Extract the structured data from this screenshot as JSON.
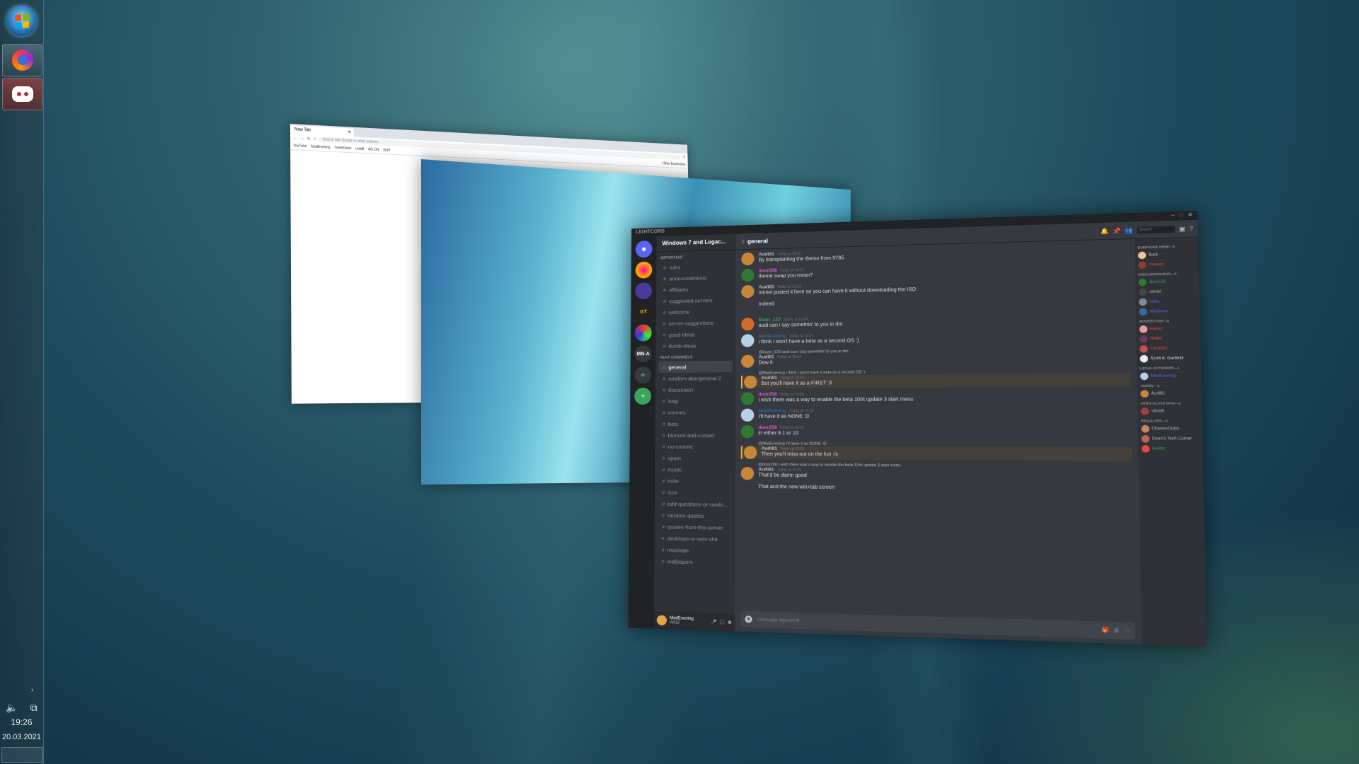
{
  "taskbar": {
    "clock": "19:26",
    "date": "20.03.2021",
    "apps": [
      {
        "name": "Firefox"
      },
      {
        "name": "Discord"
      }
    ]
  },
  "browser": {
    "tab_title": "New Tab",
    "url_placeholder": "Search with Google or enter address",
    "bookmarks": [
      "YouTube",
      "MadEvening",
      "TweetDeck",
      "reddit",
      "AG.ON",
      "Stuff"
    ],
    "other_bookmarks": "Other Bookmarks"
  },
  "discord": {
    "window_title": "LIGHTCORD",
    "server_name": "Windows 7 and Legac...",
    "categories": {
      "important": "Important",
      "text": "Text Channels"
    },
    "guild_label": "MN-A",
    "important_channels": [
      "rules",
      "announcements",
      "affiliates",
      "suggested-servers",
      "welcome",
      "server-suggestions",
      "good-ideas",
      "dumb-ideas"
    ],
    "text_channels": [
      "general",
      "random-aka-general-2",
      "discussion",
      "help",
      "memes",
      "bots",
      "blursed-and-cursed",
      "no-context",
      "spam",
      "music",
      "nsfw",
      "cum",
      "odd-questions-or-rando...",
      "random-quotes",
      "quotes-from-this-server",
      "desktops-or-som-shit",
      "mockups",
      "wallpapers"
    ],
    "active_channel": "general",
    "user": {
      "name": "MadEvening",
      "tag": "#3022"
    },
    "search_placeholder": "Search",
    "composer_placeholder": "Message #general",
    "messages": [
      {
        "author": "Audi81",
        "time": "Today at 19:20",
        "color": "#b9bbbe",
        "avatar": "#c7873a",
        "text": "By transplanting the theme from 9785",
        "reply": ""
      },
      {
        "author": "door258",
        "time": "Today at 19:22",
        "color": "#e05ad6",
        "avatar": "#2f7a33",
        "text": "theme swap you mean?",
        "reply": ""
      },
      {
        "author": "Audi81",
        "time": "Today at 19:23",
        "color": "#b9bbbe",
        "avatar": "#c7873a",
        "text": "mintel posted it here so you can have it without downloading the ISO",
        "reply": ""
      },
      {
        "author": "",
        "time": "",
        "color": "#b9bbbe",
        "avatar": "#c7873a",
        "text": "Indeed",
        "reply": ""
      },
      {
        "author": "Kaan_123",
        "time": "Today at 19:24",
        "color": "#3ba55d",
        "avatar": "#d46a2a",
        "text": "audi can i say somethin' to you in dm",
        "reply": ""
      },
      {
        "author": "MadEvening",
        "time": "Today at 19:24",
        "color": "#2a6a9a",
        "avatar": "#b8d0e6",
        "text": "i think i won't have a beta as a second OS :)",
        "reply": ""
      },
      {
        "author": "Audi81",
        "time": "Today at 19:24",
        "color": "#b9bbbe",
        "avatar": "#c7873a",
        "text": "Dew it",
        "reply": "@Kaan_123 audi can i say somethin' to you in dm"
      },
      {
        "author": "Audi81",
        "time": "Today at 19:24",
        "color": "#b9bbbe",
        "avatar": "#c7873a",
        "text": "But you'll have it as a FIRST :3",
        "reply": "@MadEvening i think i won't have a beta as a second OS :)",
        "hl": true
      },
      {
        "author": "door258",
        "time": "Today at 19:24",
        "color": "#e05ad6",
        "avatar": "#2f7a33",
        "text": "i wish there was a way to enable the beta 10/rt update 3 start menu",
        "reply": ""
      },
      {
        "author": "MadEvening",
        "time": "Today at 19:24",
        "color": "#2a6a9a",
        "avatar": "#b8d0e6",
        "text": "I'll have it as NONE :D",
        "reply": ""
      },
      {
        "author": "door258",
        "time": "Today at 19:25",
        "color": "#e05ad6",
        "avatar": "#2f7a33",
        "text": "in either 8.1 or 10",
        "reply": ""
      },
      {
        "author": "Audi81",
        "time": "Today at 19:25",
        "color": "#b9bbbe",
        "avatar": "#c7873a",
        "text": "Then you'll miss out on the fun :/s",
        "reply": "@MadEvening I'll have it as NONE :D",
        "hl": true
      },
      {
        "author": "Audi81",
        "time": "Today at 19:25",
        "color": "#b9bbbe",
        "avatar": "#c7873a",
        "text": "That'd be damn good",
        "reply": "@door258 i wish there was a way to enable the beta 10/rt update 3 start menu"
      },
      {
        "author": "",
        "time": "",
        "color": "#b9bbbe",
        "avatar": "#c7873a",
        "text": "That and the new win+tab screen",
        "reply": ""
      }
    ],
    "member_groups": [
      {
        "role": "Everyone Here—2",
        "members": [
          {
            "name": "Barb",
            "color": "#b9bbbe",
            "avatar": "#e6c8a0"
          },
          {
            "name": "Pasoan",
            "color": "#e04848",
            "avatar": "#8a3a3a"
          }
        ]
      },
      {
        "role": "Discussion Mod—4",
        "members": [
          {
            "name": "door258",
            "color": "#3ba55d",
            "avatar": "#2f7a33"
          },
          {
            "name": "mintel",
            "color": "#b9bbbe",
            "avatar": "#444"
          },
          {
            "name": "nicky",
            "color": "#5865f2",
            "avatar": "#7a8aa0"
          },
          {
            "name": "Windows",
            "color": "#5865f2",
            "avatar": "#3a6a9a"
          }
        ]
      },
      {
        "role": "Moderator—4",
        "members": [
          {
            "name": "kaicey",
            "color": "#e04848",
            "avatar": "#e0a0a0"
          },
          {
            "name": "NiMM",
            "color": "#e04848",
            "avatar": "#6a3a5a"
          },
          {
            "name": "LionBird",
            "color": "#e04848",
            "avatar": "#c05050"
          },
          {
            "name": "Scott A. Garfield",
            "color": "#dcddde",
            "avatar": "#eee"
          }
        ]
      },
      {
        "role": "Legal Extender—1",
        "members": [
          {
            "name": "MadEvening",
            "color": "#5865f2",
            "avatar": "#b8d0e6"
          }
        ]
      },
      {
        "role": "Audi81—1",
        "members": [
          {
            "name": "Audi81",
            "color": "#b9bbbe",
            "avatar": "#c7873a"
          }
        ]
      },
      {
        "role": "Aero Glass Mod—1",
        "members": [
          {
            "name": "Vitral5",
            "color": "#b9bbbe",
            "avatar": "#a04040"
          }
        ]
      },
      {
        "role": "Regulars—3",
        "members": [
          {
            "name": "CharlesClubs",
            "color": "#b9bbbe",
            "avatar": "#d08060"
          },
          {
            "name": "Dean's Tech Corner",
            "color": "#b9bbbe",
            "avatar": "#c06060"
          },
          {
            "name": "Holder",
            "color": "#3ba55d",
            "avatar": "#e04848"
          }
        ]
      }
    ]
  }
}
